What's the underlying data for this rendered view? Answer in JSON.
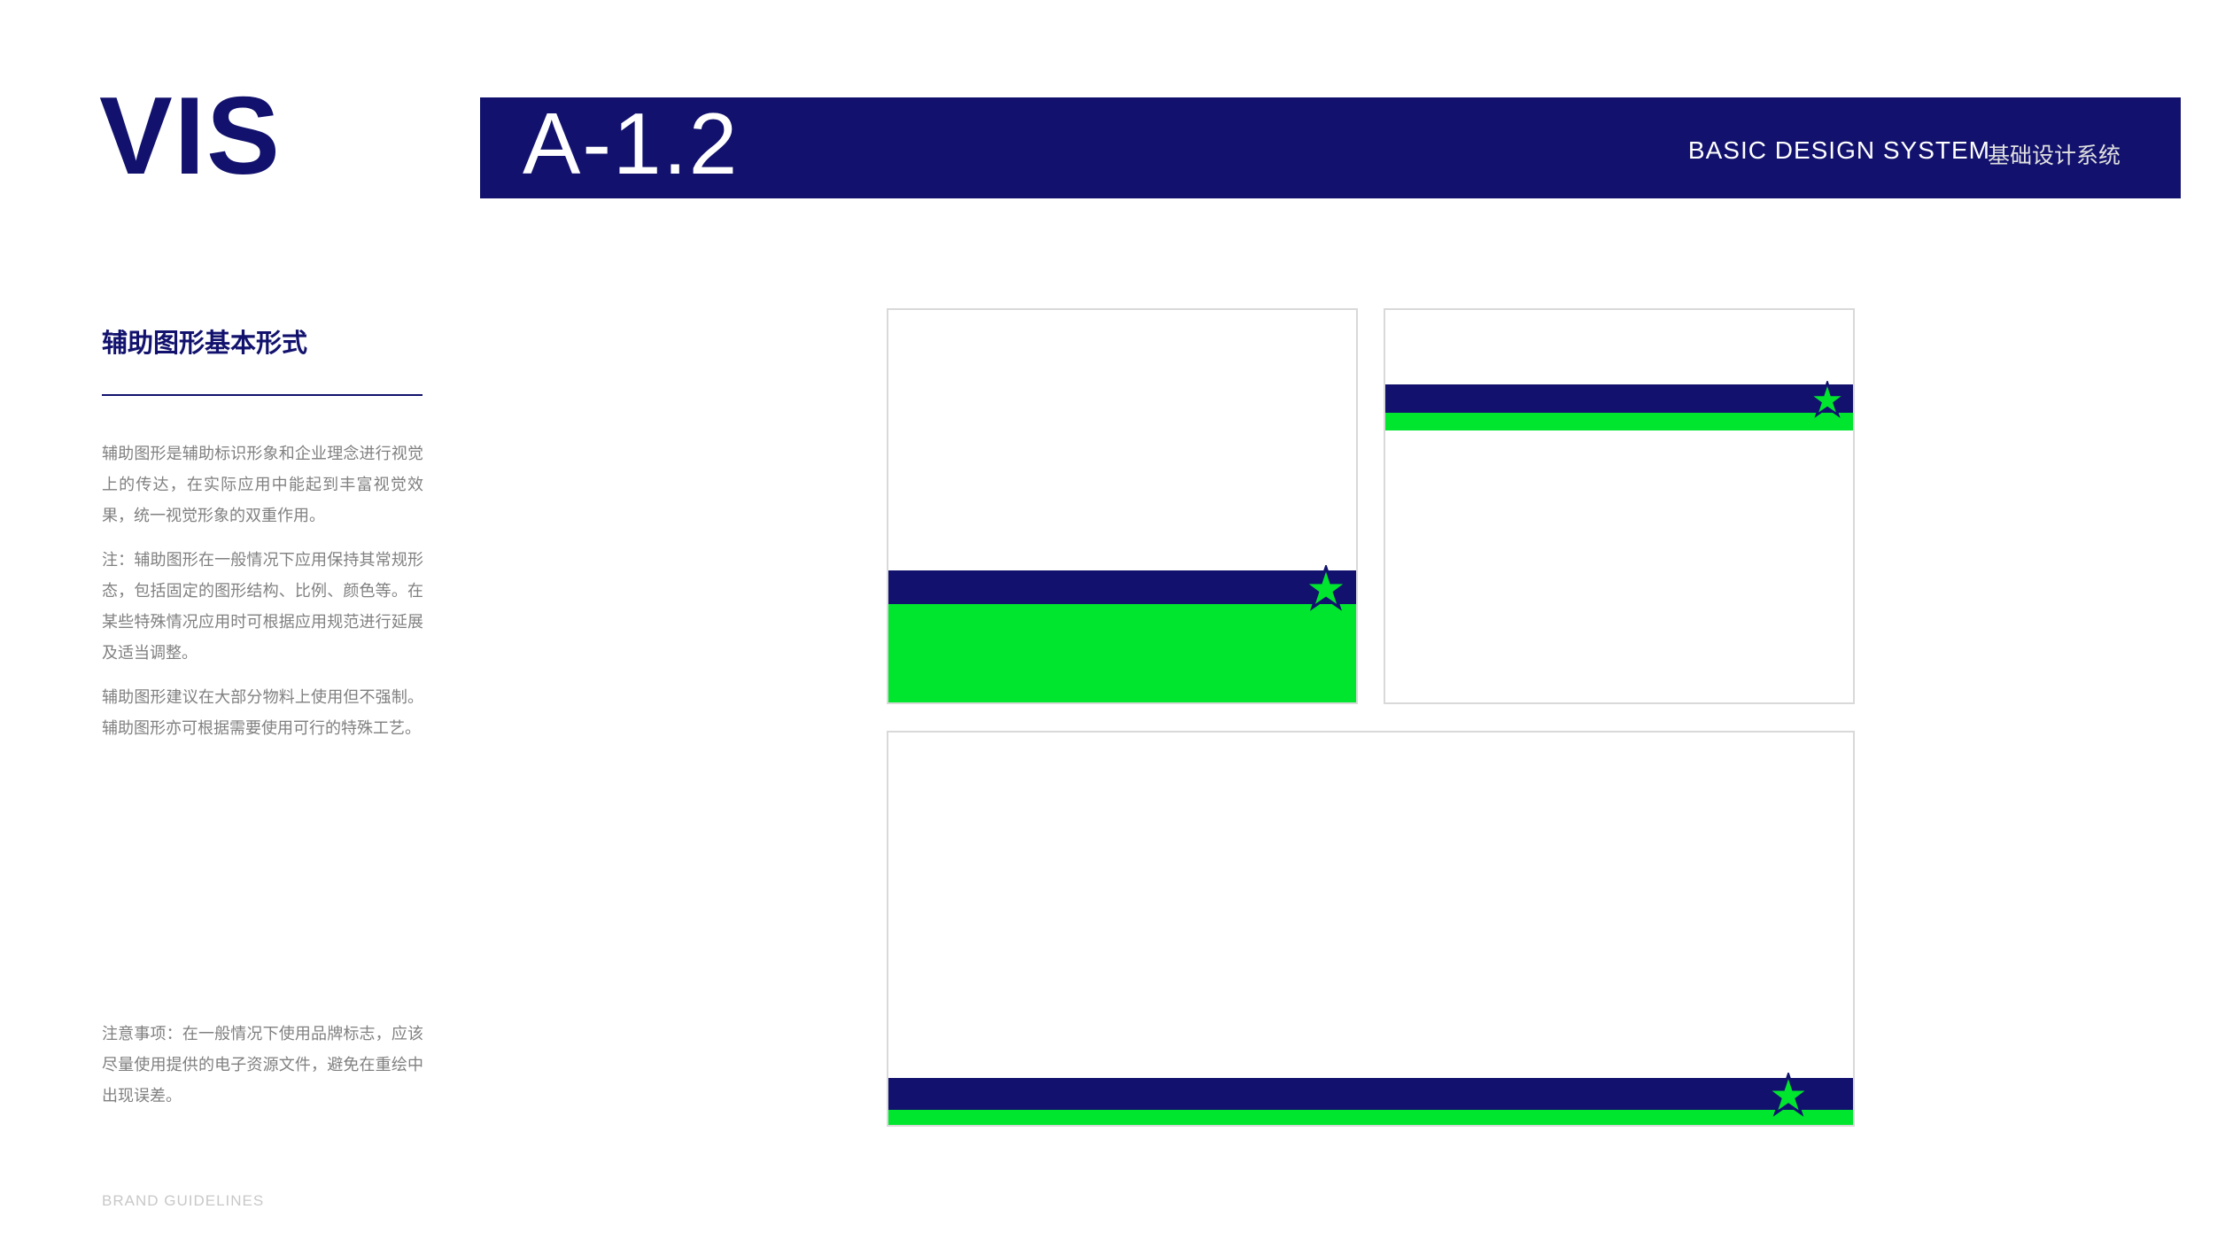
{
  "logo": "VIS",
  "header": {
    "code": "A-1.2",
    "title_en": "BASIC DESIGN SYSTEM",
    "title_cn": "基础设计系统"
  },
  "section_title": "辅助图形基本形式",
  "paragraphs": {
    "p1": "辅助图形是辅助标识形象和企业理念进行视觉上的传达，在实际应用中能起到丰富视觉效果，统一视觉形象的双重作用。",
    "p2": "注：辅助图形在一般情况下应用保持其常规形态，包括固定的图形结构、比例、颜色等。在某些特殊情况应用时可根据应用规范进行延展及适当调整。",
    "p3": "辅助图形建议在大部分物料上使用但不强制。辅助图形亦可根据需要使用可行的特殊工艺。",
    "p4": "注意事项：在一般情况下使用品牌标志，应该尽量使用提供的电子资源文件，避免在重绘中出现误差。"
  },
  "footer": "BRAND GUIDELINES",
  "colors": {
    "navy": "#12126e",
    "green": "#00e62e",
    "border": "#d9d9d9",
    "text_muted": "#808080"
  },
  "icons": {
    "star": "star-icon"
  }
}
